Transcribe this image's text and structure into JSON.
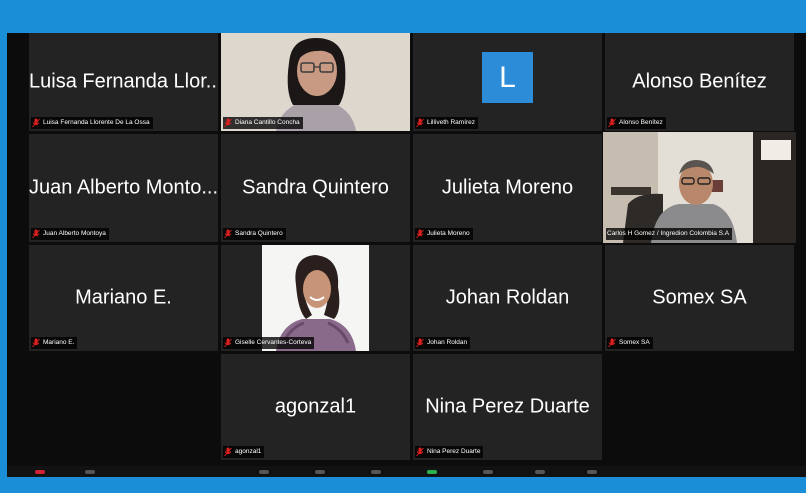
{
  "meeting": {
    "participants": [
      {
        "name": "Luisa Fernanda Llor...",
        "label": "Luisa Fernanda Llorente De La Ossa"
      },
      {
        "name": "",
        "label": "Diana Cantillo Concha"
      },
      {
        "name": "",
        "avatar_letter": "L",
        "label": "Lilliveth Ramírez"
      },
      {
        "name": "Alonso Benítez",
        "label": "Alonso Benítez"
      },
      {
        "name": "Juan Alberto Monto...",
        "label": "Juan Alberto Montoya"
      },
      {
        "name": "Sandra Quintero",
        "label": "Sandra Quintero"
      },
      {
        "name": "Julieta Moreno",
        "label": "Julieta Moreno"
      },
      {
        "name": "",
        "label": "Carlos H Gomez / Ingredion Colombia S.A"
      },
      {
        "name": "Mariano E.",
        "label": "Mariano E."
      },
      {
        "name": "",
        "label": "Giselle Cervantes-Corteva"
      },
      {
        "name": "Johan Roldan",
        "label": "Johan Roldan"
      },
      {
        "name": "Somex SA",
        "label": "Somex SA"
      },
      {
        "name": "agonzal1",
        "label": "agonzal1"
      },
      {
        "name": "Nina Perez Duarte",
        "label": "Nina Perez Duarte"
      }
    ]
  },
  "colors": {
    "window_border": "#1a8fd8",
    "tile_bg": "#232323",
    "active_speaker": "#c9e06a",
    "muted_mic": "#e02020",
    "avatar_bg": "#2d8cd8"
  },
  "icons": {
    "muted": "mic-muted-icon"
  }
}
